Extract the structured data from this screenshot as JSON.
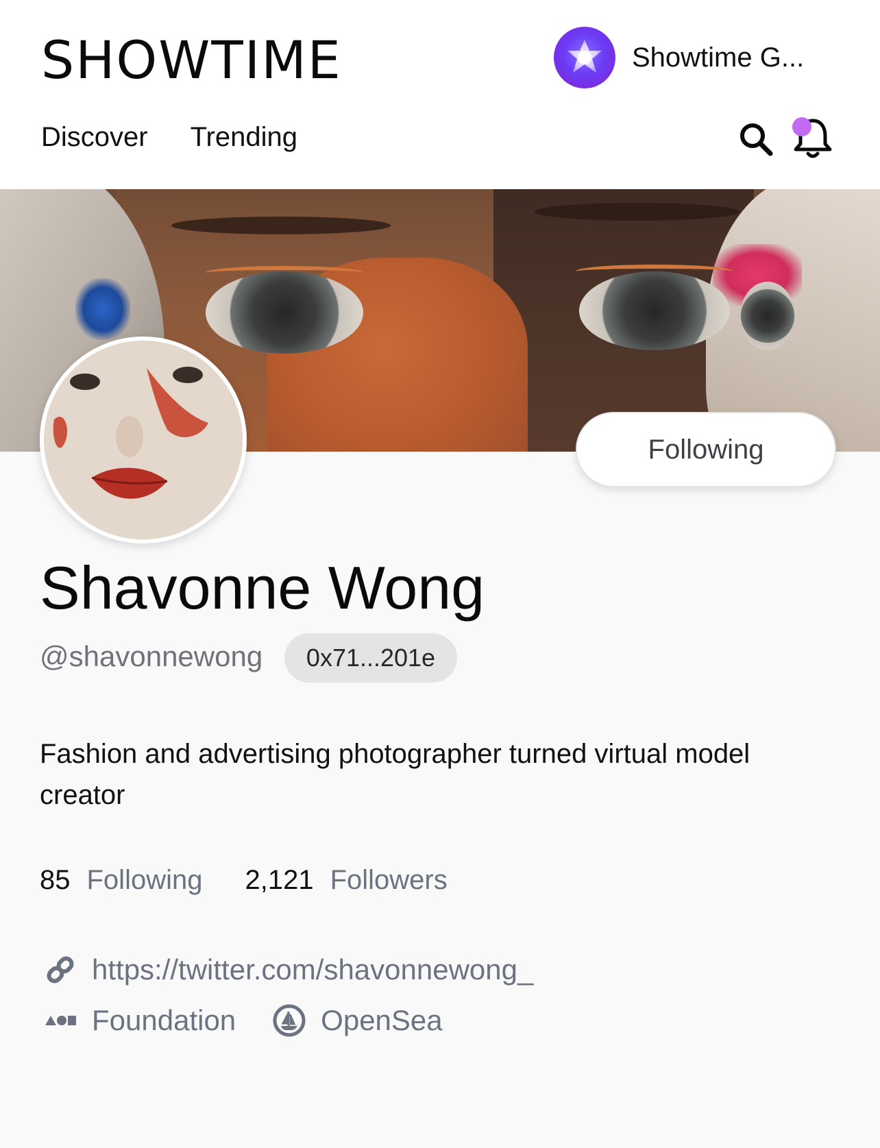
{
  "header": {
    "logo": "SHOWTIME",
    "account_name": "Showtime G...",
    "nav": [
      "Discover",
      "Trending"
    ]
  },
  "colors": {
    "notification_dot": "#c06bf2",
    "account_avatar": "#6a3cf5",
    "chip_bg": "#e4e4e7",
    "muted_text": "#6b7280"
  },
  "profile": {
    "follow_button": "Following",
    "name": "Shavonne Wong",
    "handle": "@shavonnewong",
    "address": "0x71...201e",
    "bio": "Fashion and advertising photographer turned virtual model creator",
    "stats": {
      "following_count": "85",
      "following_label": "Following",
      "followers_count": "2,121",
      "followers_label": "Followers"
    },
    "links": {
      "website": "https://twitter.com/shavonnewong_",
      "foundation": "Foundation",
      "opensea": "OpenSea"
    }
  },
  "icons": [
    "star-icon",
    "search-icon",
    "bell-icon",
    "link-icon",
    "foundation-icon",
    "opensea-icon"
  ]
}
